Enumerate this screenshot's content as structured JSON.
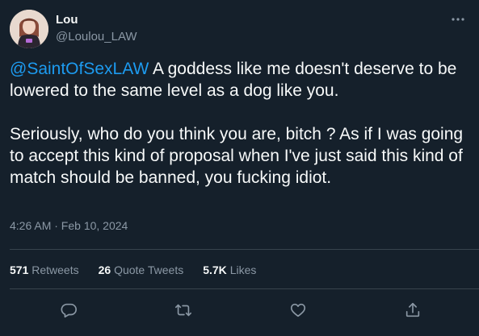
{
  "author": {
    "display_name": "Lou",
    "handle": "@Loulou_LAW"
  },
  "tweet": {
    "mention": "@SaintOfSexLAW",
    "paragraph1_rest": " A goddess like me doesn't deserve to be lowered to the same level as a dog like you.",
    "paragraph2": "Seriously, who do you think you are, bitch ? As if I was going to accept this kind of proposal when I've just said this kind of match should be banned, you fucking idiot.",
    "timestamp": "4:26 AM · Feb 10, 2024"
  },
  "stats": {
    "retweets_count": "571",
    "retweets_label": "Retweets",
    "quote_count": "26",
    "quote_label": "Quote Tweets",
    "likes_count": "5.7K",
    "likes_label": "Likes"
  },
  "icons": {
    "more": "more-icon",
    "reply": "reply-icon",
    "retweet": "retweet-icon",
    "like": "like-icon",
    "share": "share-icon"
  },
  "colors": {
    "background": "#15202b",
    "text": "#f7f9f9",
    "secondary": "#8b98a5",
    "link": "#1d9bf0",
    "divider": "#38444d"
  }
}
